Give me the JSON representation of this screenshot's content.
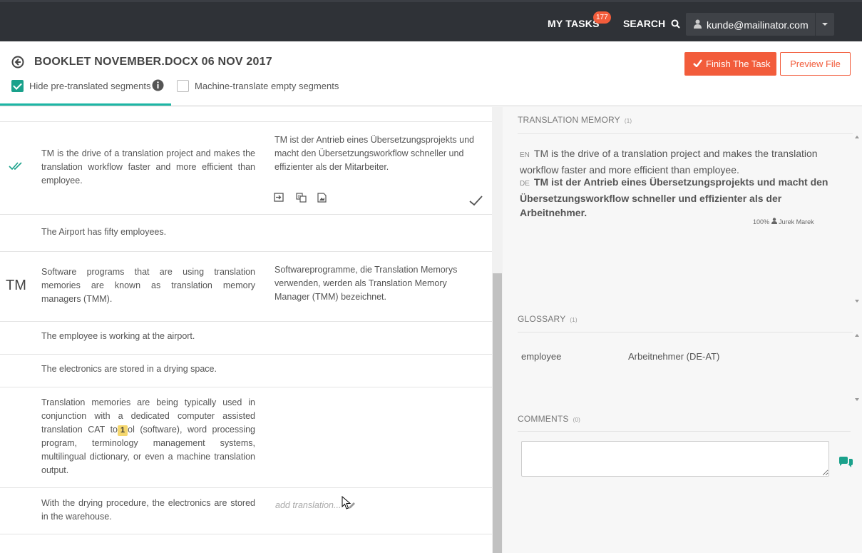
{
  "topbar": {
    "my_tasks_label": "MY TASKS",
    "tasks_count": "177",
    "search_label": "SEARCH",
    "user_email": "kunde@mailinator.com"
  },
  "header": {
    "document_title": "BOOKLET NOVEMBER.DOCX 06 NOV 2017",
    "hide_pretranslated_label": "Hide pre-translated segments",
    "hide_pretranslated_checked": true,
    "machine_translate_label": "Machine-translate empty segments",
    "machine_translate_checked": false,
    "finish_button_label": "Finish The Task",
    "preview_button_label": "Preview File"
  },
  "segments": [
    {
      "source": "TM is the drive of a translation project and makes the translation workflow faster and more efficient than employee.",
      "target": "TM ist der Antrieb eines Übersetzungsprojekts und macht den Übersetzungsworkflow schneller und effizienter als der Mitarbeiter.",
      "status_icon": "double-check-icon",
      "confirmed": true
    },
    {
      "source": "The Airport has fifty employees.",
      "target": ""
    },
    {
      "source": "Software programs that are using translation memories are known as translation memory managers (TMM).",
      "target": "Softwareprogramme, die Translation Memorys verwenden, werden als Translation Memory Manager (TMM) bezeichnet.",
      "origin_label": "TM"
    },
    {
      "source": "The employee is working at the airport.",
      "target": ""
    },
    {
      "source": "The electronics are stored in a drying space.",
      "target": ""
    },
    {
      "source_before_tag": "Translation memories are being typically used in conjunction with a dedicated computer assisted translation CAT to",
      "tag": "1",
      "source_after_tag": "ol (software), word processing program, terminology management systems, multilingual dictionary, or even a machine translation output.",
      "target": ""
    },
    {
      "source": "With the drying procedure, the electronics are stored in the warehouse.",
      "target_placeholder": "add translation..."
    }
  ],
  "translation_memory": {
    "title": "TRANSLATION MEMORY",
    "count": "(1)",
    "source_lang": "EN",
    "source_text": "TM is the drive of a translation project and makes the translation workflow faster and more efficient than employee.",
    "target_lang": "DE",
    "target_text": "TM ist der Antrieb eines Übersetzungsprojekts und macht den Übersetzungsworkflow schneller und effizienter als der Arbeitnehmer.",
    "match": "100%",
    "author": "Jurek Marek"
  },
  "glossary": {
    "title": "GLOSSARY",
    "count": "(1)",
    "term": "employee",
    "translation": "Arbeitnehmer (DE-AT)"
  },
  "comments": {
    "title": "COMMENTS",
    "count": "(0)"
  },
  "colors": {
    "accent": "#f25c3b",
    "teal": "#1aa18b",
    "topbar": "#2f3237"
  }
}
